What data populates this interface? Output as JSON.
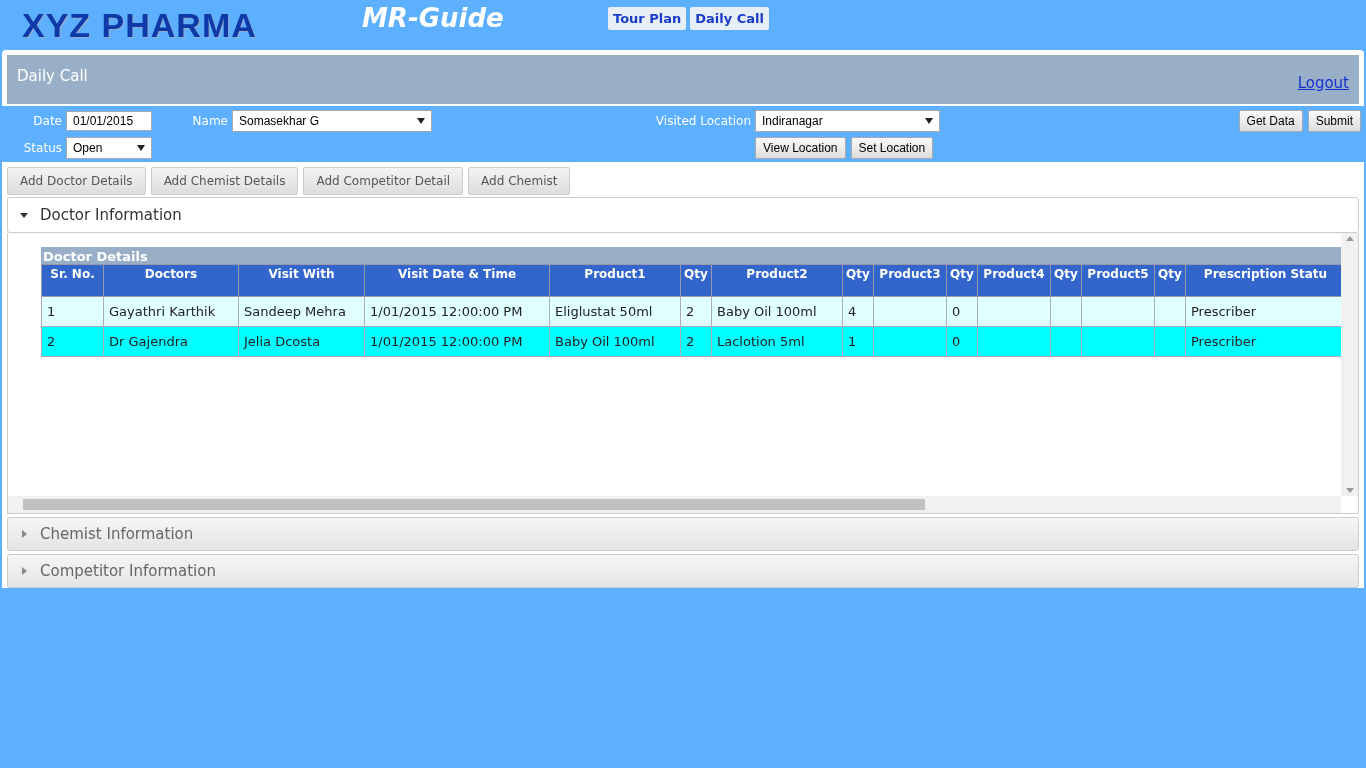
{
  "header": {
    "logo": "XYZ PHARMA",
    "app_title": "MR-Guide",
    "nav": [
      {
        "label": "Tour Plan"
      },
      {
        "label": "Daily Call"
      }
    ]
  },
  "page": {
    "title": "Daily Call",
    "logout": "Logout"
  },
  "form": {
    "date_label": "Date",
    "date": "01/01/2015",
    "name_label": "Name",
    "name": "Somasekhar G",
    "status_label": "Status",
    "status": "Open",
    "location_label": "Visited Location",
    "location": "Indiranagar",
    "location_buttons": [
      "View Location",
      "Set Location"
    ],
    "buttons": [
      "Get Data",
      "Submit"
    ]
  },
  "action_buttons": [
    "Add Doctor Details",
    "Add Chemist Details",
    "Add Competitor Detail",
    "Add Chemist"
  ],
  "sections": [
    {
      "title": "Doctor Information",
      "expanded": true
    },
    {
      "title": "Chemist Information",
      "expanded": false
    },
    {
      "title": "Competitor Information",
      "expanded": false
    }
  ],
  "table": {
    "caption": "Doctor Details",
    "columns": [
      "Sr. No.",
      "Doctors",
      "Visit With",
      "Visit Date & Time",
      "Product1",
      "Qty",
      "Product2",
      "Qty",
      "Product3",
      "Qty",
      "Product4",
      "Qty",
      "Product5",
      "Qty",
      "Prescription Statu"
    ],
    "rows": [
      [
        "1",
        "Gayathri Karthik",
        "Sandeep Mehra",
        "1/01/2015 12:00:00 PM",
        "Eliglustat 50ml",
        "2",
        "Baby Oil 100ml",
        "4",
        "",
        "0",
        "",
        "",
        "",
        "",
        "Prescriber"
      ],
      [
        "2",
        "Dr Gajendra",
        "Jelia Dcosta",
        "1/01/2015 12:00:00 PM",
        "Baby Oil 100ml",
        "2",
        "Laclotion 5ml",
        "1",
        "",
        "0",
        "",
        "",
        "",
        "",
        "Prescriber"
      ]
    ]
  }
}
